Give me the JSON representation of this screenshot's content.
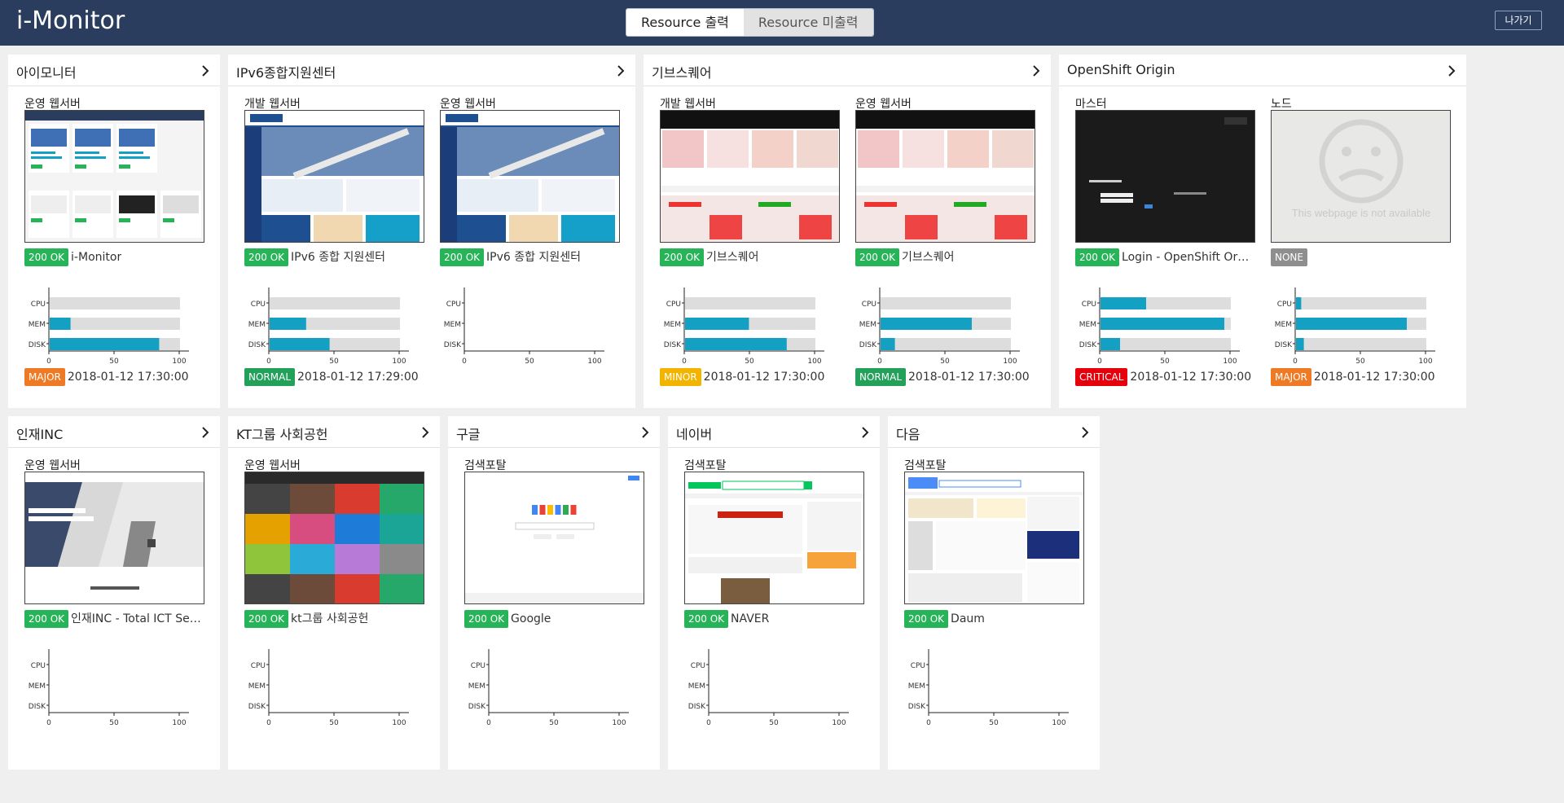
{
  "header": {
    "logo": "i-Monitor",
    "toggle": [
      "Resource 출력",
      "Resource 미출력"
    ],
    "exit": "나가기"
  },
  "axis": {
    "labels": [
      "CPU",
      "MEM",
      "DISK"
    ],
    "ticks": [
      "0",
      "50",
      "100"
    ]
  },
  "groups": [
    {
      "title": "아이모니터",
      "servers": [
        {
          "label": "운영 웹서버",
          "status": "200 OK",
          "site": "i-Monitor",
          "thumb": "imonitor",
          "cpu": 0,
          "mem": 16,
          "disk": 84,
          "has_resource": true,
          "alarm": "MAJOR",
          "time": "2018-01-12 17:30:00"
        }
      ]
    },
    {
      "title": "IPv6종합지원센터",
      "servers": [
        {
          "label": "개발 웹서버",
          "status": "200 OK",
          "site": "IPv6 종합 지원센터",
          "thumb": "ipv6",
          "cpu": 0,
          "mem": 28,
          "disk": 46,
          "has_resource": true,
          "alarm": "NORMAL",
          "time": "2018-01-12 17:29:00"
        },
        {
          "label": "운영 웹서버",
          "status": "200 OK",
          "site": "IPv6 종합 지원센터",
          "thumb": "ipv6",
          "cpu": 0,
          "mem": 0,
          "disk": 0,
          "has_resource": false,
          "alarm": "",
          "time": ""
        }
      ]
    },
    {
      "title": "기브스퀘어",
      "servers": [
        {
          "label": "개발 웹서버",
          "status": "200 OK",
          "site": "기브스퀘어",
          "thumb": "give",
          "cpu": 0,
          "mem": 49,
          "disk": 78,
          "has_resource": true,
          "alarm": "MINOR",
          "time": "2018-01-12 17:30:00"
        },
        {
          "label": "운영 웹서버",
          "status": "200 OK",
          "site": "기브스퀘어",
          "thumb": "give",
          "cpu": 0,
          "mem": 70,
          "disk": 11,
          "has_resource": true,
          "alarm": "NORMAL",
          "time": "2018-01-12 17:30:00"
        }
      ]
    },
    {
      "title": "OpenShift Origin",
      "servers": [
        {
          "label": "마스터",
          "status": "200 OK",
          "site": "Login - OpenShift Origin",
          "thumb": "openshift",
          "cpu": 35,
          "mem": 95,
          "disk": 15,
          "has_resource": true,
          "alarm": "CRITICAL",
          "time": "2018-01-12 17:30:00"
        },
        {
          "label": "노드",
          "status": "NONE",
          "site": "",
          "thumb": "na",
          "na_text": "This webpage is not available",
          "cpu": 4,
          "mem": 85,
          "disk": 6,
          "has_resource": true,
          "alarm": "MAJOR",
          "time": "2018-01-12 17:30:00"
        }
      ]
    },
    {
      "title": "인재INC",
      "servers": [
        {
          "label": "운영 웹서버",
          "status": "200 OK",
          "site": "인재INC - Total ICT Service",
          "thumb": "injae",
          "has_resource": false,
          "alarm": "",
          "time": ""
        }
      ]
    },
    {
      "title": "KT그룹 사회공헌",
      "servers": [
        {
          "label": "운영 웹서버",
          "status": "200 OK",
          "site": "kt그룹 사회공헌",
          "thumb": "kt",
          "has_resource": false,
          "alarm": "",
          "time": ""
        }
      ]
    },
    {
      "title": "구글",
      "servers": [
        {
          "label": "검색포탈",
          "status": "200 OK",
          "site": "Google",
          "thumb": "google",
          "has_resource": false,
          "alarm": "",
          "time": ""
        }
      ]
    },
    {
      "title": "네이버",
      "servers": [
        {
          "label": "검색포탈",
          "status": "200 OK",
          "site": "NAVER",
          "thumb": "naver",
          "has_resource": false,
          "alarm": "",
          "time": ""
        }
      ]
    },
    {
      "title": "다음",
      "servers": [
        {
          "label": "검색포탈",
          "status": "200 OK",
          "site": "Daum",
          "thumb": "daum",
          "has_resource": false,
          "alarm": "",
          "time": ""
        }
      ]
    }
  ],
  "colors": {
    "header_bg": "#2a3d5e",
    "bar_fill": "#13a0c2",
    "bar_track": "#dddddd",
    "ok": "#27b358",
    "major": "#ef7a26",
    "normal": "#23a15a",
    "minor": "#f3b400",
    "critical": "#e5000b",
    "none": "#8e8e8e"
  }
}
